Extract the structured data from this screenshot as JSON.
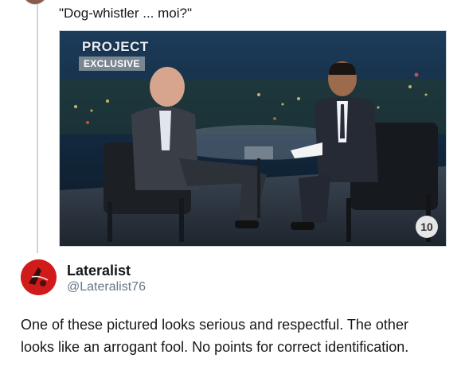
{
  "quoted": {
    "text": "\"Dog-whistler ... moi?\""
  },
  "media": {
    "logo_line1": "PROJECT",
    "logo_line2": "EXCLUSIVE",
    "channel_logo": "10"
  },
  "author": {
    "name": "Lateralist",
    "handle": "@Lateralist76"
  },
  "tweet": {
    "text": "One of these pictured looks serious and respectful. The other looks like an arrogant fool. No points for correct identification."
  },
  "colors": {
    "avatar_red": "#d11a1a",
    "handle_gray": "#657786"
  }
}
